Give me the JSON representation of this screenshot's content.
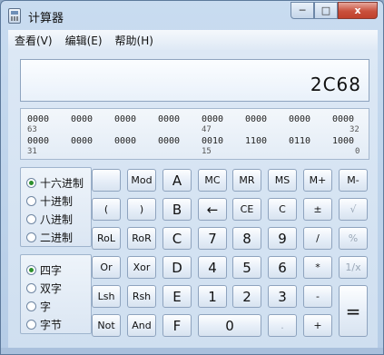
{
  "window": {
    "title": "计算器",
    "controls": {
      "minimize": "─",
      "maximize": "□",
      "close": "x"
    }
  },
  "menu": [
    "查看(V)",
    "编辑(E)",
    "帮助(H)"
  ],
  "display": {
    "value": "2C68"
  },
  "bits": {
    "row1": [
      "0000",
      "0000",
      "0000",
      "0000",
      "0000",
      "0000",
      "0000",
      "0000"
    ],
    "row1_positions": [
      "63",
      "47",
      "32"
    ],
    "row2": [
      "0000",
      "0000",
      "0000",
      "0000",
      "0010",
      "1100",
      "0110",
      "1000"
    ],
    "row2_positions": [
      "31",
      "15",
      "0"
    ]
  },
  "base_options": [
    "十六进制",
    "十进制",
    "八进制",
    "二进制"
  ],
  "base_selected": 0,
  "word_options": [
    "四字",
    "双字",
    "字",
    "字节"
  ],
  "word_selected": 0,
  "keys": {
    "r1": [
      "",
      "Mod",
      "A",
      "MC",
      "MR",
      "MS",
      "M+",
      "M-"
    ],
    "r2": [
      "(",
      ")",
      "B",
      "←",
      "CE",
      "C",
      "±",
      "√"
    ],
    "r3": [
      "RoL",
      "RoR",
      "C",
      "7",
      "8",
      "9",
      "/",
      "%"
    ],
    "r4": [
      "Or",
      "Xor",
      "D",
      "4",
      "5",
      "6",
      "*",
      "1/x"
    ],
    "r5": [
      "Lsh",
      "Rsh",
      "E",
      "1",
      "2",
      "3",
      "-",
      "="
    ],
    "r6": [
      "Not",
      "And",
      "F",
      "0",
      ".",
      "+"
    ]
  }
}
